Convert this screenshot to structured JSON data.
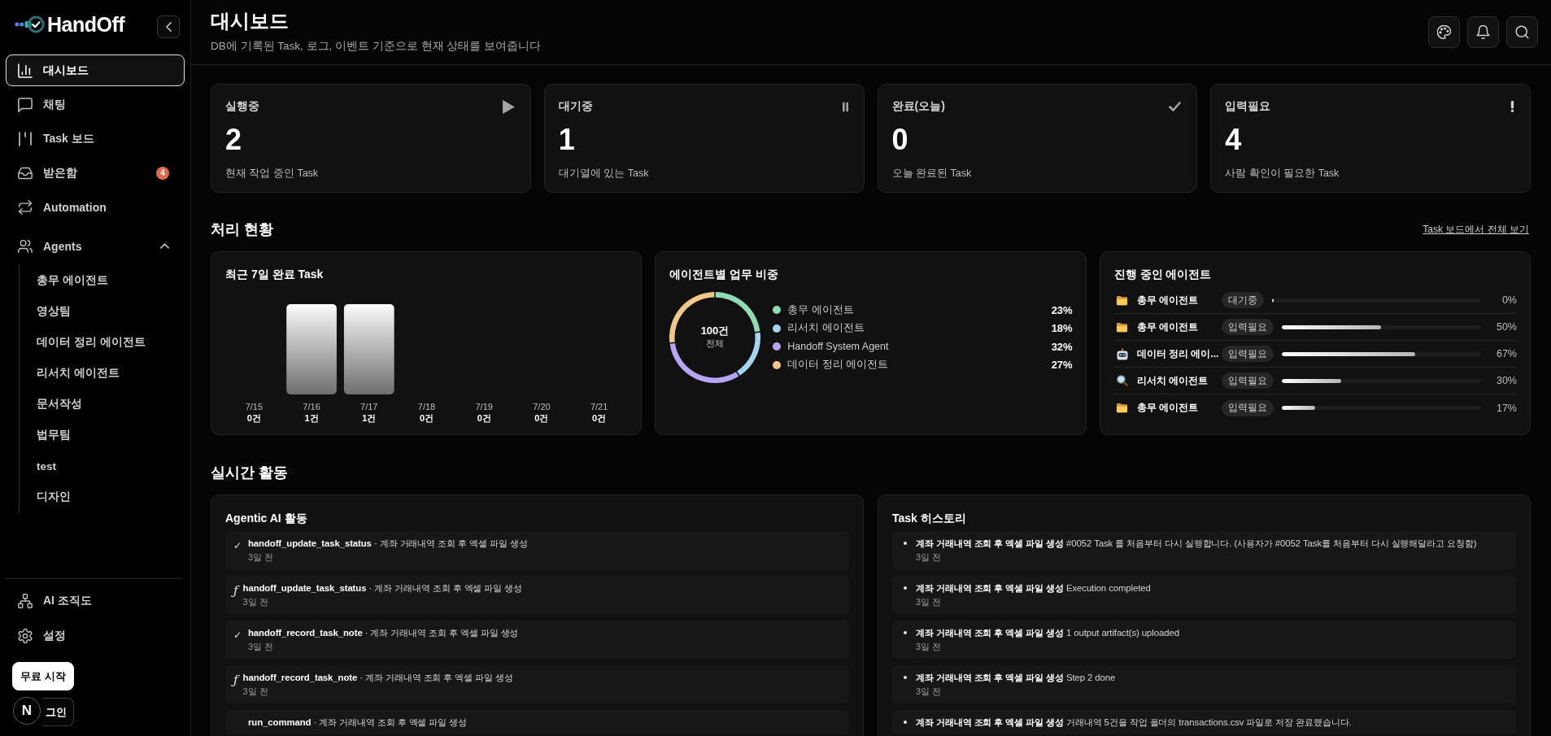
{
  "sidebar": {
    "brand": "HandOff",
    "nav": [
      {
        "kind": "dashboard",
        "label": "대시보드",
        "selected": true
      },
      {
        "kind": "chat",
        "label": "채팅",
        "selected": false
      },
      {
        "kind": "board",
        "label": "Task 보드",
        "selected": false
      },
      {
        "kind": "inbox",
        "label": "받은함",
        "selected": false,
        "badge": "4"
      },
      {
        "kind": "automation",
        "label": "Automation",
        "selected": false
      },
      {
        "kind": "agents",
        "label": "Agents",
        "selected": false,
        "expanded": true,
        "children": [
          {
            "label": "총무 에이전트",
            "selected": false
          },
          {
            "label": "영상팀",
            "selected": false
          },
          {
            "label": "데이터 정리 에이전트",
            "selected": false
          },
          {
            "label": "리서치 에이전트",
            "selected": false
          },
          {
            "label": "문서작성",
            "selected": false
          },
          {
            "label": "법무팀",
            "selected": false
          },
          {
            "label": "test",
            "selected": false
          },
          {
            "label": "디자인",
            "selected": false
          }
        ]
      }
    ],
    "footer_nav": [
      {
        "kind": "org",
        "label": "AI 조직도",
        "selected": false
      },
      {
        "kind": "settings",
        "label": "설정",
        "selected": false
      }
    ],
    "buttons": [
      {
        "kind": "primary",
        "label": "무료 시작"
      },
      {
        "kind": "outline",
        "label": "그인"
      }
    ],
    "dev_indicator": "N"
  },
  "header": {
    "title": "대시보드",
    "subtitle": "DB에 기록된 Task, 로그, 이벤트 기준으로 현재 상태를 보여줍니다"
  },
  "stats": [
    {
      "kind": "running",
      "label": "실행중",
      "value": "2",
      "caption": "현재 작업 중인 Task"
    },
    {
      "kind": "queued",
      "label": "대기중",
      "value": "1",
      "caption": "대기열에 있는 Task"
    },
    {
      "kind": "completed",
      "label": "완료(오늘)",
      "value": "0",
      "caption": "오늘 완료된 Task"
    },
    {
      "kind": "needs_input",
      "label": "입력필요",
      "value": "4",
      "caption": "사람 확인이 필요한 Task"
    }
  ],
  "processing": {
    "title": "처리 현황",
    "link": "Task 보드에서 전체 보기",
    "completed_chart": {
      "title": "최근 7일 완료 Task",
      "chart_data": {
        "type": "bar",
        "categories": [
          "7/15",
          "7/16",
          "7/17",
          "7/18",
          "7/19",
          "7/20",
          "7/21"
        ],
        "values": [
          0,
          1,
          1,
          0,
          0,
          0,
          0
        ],
        "value_labels": [
          "0건",
          "1건",
          "1건",
          "0건",
          "0건",
          "0건",
          "0건"
        ]
      }
    },
    "agent_share": {
      "title": "에이전트별 업무 비중",
      "center_value": "100건",
      "center_caption": "전체",
      "chart_data": {
        "type": "donut",
        "categories": [
          "총무 에이전트",
          "리서치 에이전트",
          "Handoff System Agent",
          "데이터 정리 에이전트"
        ],
        "values": [
          23,
          18,
          32,
          27
        ],
        "colors": [
          "#8fdcb4",
          "#a3d5ee",
          "#b7a4f4",
          "#f0c885"
        ],
        "value_labels": [
          "23%",
          "18%",
          "32%",
          "27%"
        ],
        "legend": "right"
      }
    },
    "active_agents": {
      "title": "진행 중인 에이전트",
      "rows": [
        {
          "kind": "folder",
          "name": "총무 에이전트",
          "status": "대기중",
          "level": 0,
          "percent": "0%"
        },
        {
          "kind": "folder",
          "name": "총무 에이전트",
          "status": "입력필요",
          "level": 0.5,
          "percent": "50%"
        },
        {
          "kind": "robot",
          "name": "데이터 정리 에이...",
          "status": "입력필요",
          "level": 0.67,
          "percent": "67%"
        },
        {
          "kind": "magnifier",
          "name": "리서치 에이전트",
          "status": "입력필요",
          "level": 0.3,
          "percent": "30%"
        },
        {
          "kind": "folder",
          "name": "총무 에이전트",
          "status": "입력필요",
          "level": 0.17,
          "percent": "17%"
        }
      ]
    }
  },
  "activity": {
    "title": "실시간 활동",
    "agentic": {
      "title": "Agentic AI 활동",
      "items": [
        {
          "kind": "check",
          "icon": "✓",
          "title": "**handoff_update_task_status** · 계좌 거래내역 조회 후 엑셀 파일 생성",
          "time": "3일 전"
        },
        {
          "kind": "function",
          "icon": "ƒ",
          "title": "**handoff_update_task_status** · 계좌 거래내역 조회 후 엑셀 파일 생성",
          "time": "3일 전"
        },
        {
          "kind": "check",
          "icon": "✓",
          "title": "**handoff_record_task_note** · 계좌 거래내역 조회 후 엑셀 파일 생성",
          "time": "3일 전"
        },
        {
          "kind": "function",
          "icon": "ƒ",
          "title": "**handoff_record_task_note** · 계좌 거래내역 조회 후 엑셀 파일 생성",
          "time": "3일 전"
        },
        {
          "title": "**run_command** · 계좌 거래내역 조회 후 엑셀 파일 생성"
        }
      ]
    },
    "history": {
      "title": "Task 히스토리",
      "items": [
        {
          "text": "**계좌 거래내역 조회 후 엑셀 파일 생성** #0052 Task 를 처음부터 다시 실행합니다. (사용자가 #0052 Task를 처음부터 다시 실행해달라고 요청함)",
          "time": "3일 전"
        },
        {
          "text": "**계좌 거래내역 조회 후 엑셀 파일 생성** Execution completed",
          "time": "3일 전"
        },
        {
          "text": "**계좌 거래내역 조회 후 엑셀 파일 생성** 1 output artifact(s) uploaded",
          "time": "3일 전"
        },
        {
          "text": "**계좌 거래내역 조회 후 엑셀 파일 생성** Step 2 done",
          "time": "3일 전"
        },
        {
          "text": "**계좌 거래내역 조회 후 엑셀 파일 생성** 거래내역 5건을 작업 폴더의 transactions.csv 파일로 저장 완료했습니다."
        }
      ]
    }
  }
}
